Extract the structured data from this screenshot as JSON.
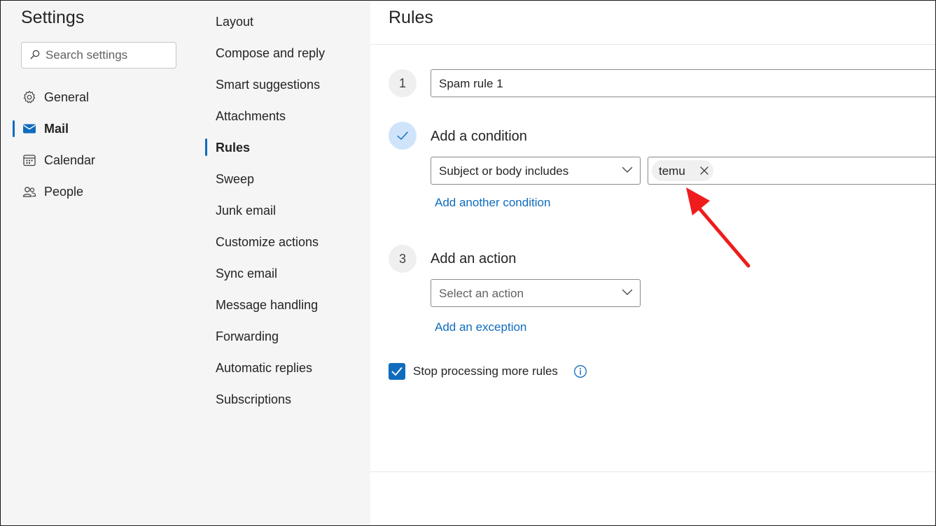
{
  "settings_pane": {
    "title": "Settings",
    "search_placeholder": "Search settings",
    "categories": [
      {
        "label": "General",
        "icon": "gear-icon"
      },
      {
        "label": "Mail",
        "icon": "mail-icon",
        "active": true
      },
      {
        "label": "Calendar",
        "icon": "calendar-icon"
      },
      {
        "label": "People",
        "icon": "people-icon"
      }
    ]
  },
  "mail_menu": {
    "items": [
      "Layout",
      "Compose and reply",
      "Smart suggestions",
      "Attachments",
      "Rules",
      "Sweep",
      "Junk email",
      "Customize actions",
      "Sync email",
      "Message handling",
      "Forwarding",
      "Automatic replies",
      "Subscriptions"
    ],
    "active_item": "Rules"
  },
  "rule_editor": {
    "title": "Rules",
    "step1": {
      "number": "1",
      "rule_name": "Spam rule 1"
    },
    "step2": {
      "label": "Add a condition",
      "condition": "Subject or body includes",
      "tag": "temu",
      "add_condition_link": "Add another condition"
    },
    "step3": {
      "number": "3",
      "label": "Add an action",
      "action_placeholder": "Select an action",
      "add_exception_link": "Add an exception"
    },
    "stop_processing": {
      "label": "Stop processing more rules",
      "checked": true
    }
  },
  "colors": {
    "accent": "#0f6cbd",
    "annotation_arrow": "#ee1c1c",
    "pane_background": "#f5f5f5"
  }
}
